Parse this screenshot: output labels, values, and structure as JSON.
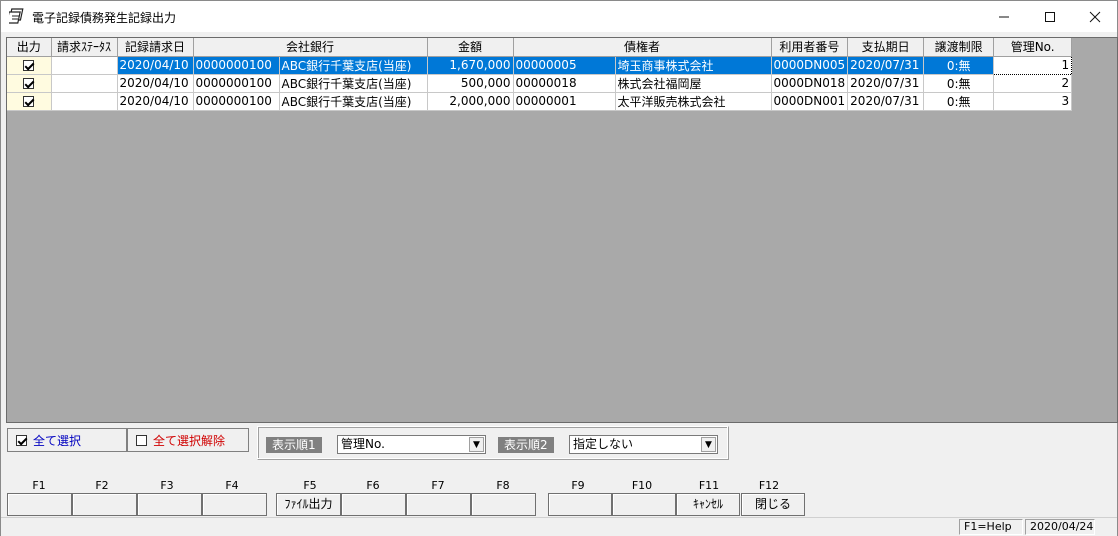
{
  "window": {
    "title": "電子記録債務発生記録出力"
  },
  "grid": {
    "columns": [
      "出力",
      "請求ｽﾃｰﾀｽ",
      "記録請求日",
      "会社銀行",
      "金額",
      "債権者",
      "利用者番号",
      "支払期日",
      "譲渡制限",
      "管理No."
    ],
    "rows": [
      {
        "checked": true,
        "status": "",
        "date": "2020/04/10",
        "company_code": "0000000100",
        "bank": "ABC銀行千葉支店(当座)",
        "amount": "1,670,000",
        "creditor_code": "00000005",
        "creditor_name": "埼玉商事株式会社",
        "user_no": "0000DN005",
        "due_date": "2020/07/31",
        "transfer": "0:無",
        "mgr_no": "1"
      },
      {
        "checked": true,
        "status": "",
        "date": "2020/04/10",
        "company_code": "0000000100",
        "bank": "ABC銀行千葉支店(当座)",
        "amount": "500,000",
        "creditor_code": "00000018",
        "creditor_name": "株式会社福岡屋",
        "user_no": "0000DN018",
        "due_date": "2020/07/31",
        "transfer": "0:無",
        "mgr_no": "2"
      },
      {
        "checked": true,
        "status": "",
        "date": "2020/04/10",
        "company_code": "0000000100",
        "bank": "ABC銀行千葉支店(当座)",
        "amount": "2,000,000",
        "creditor_code": "00000001",
        "creditor_name": "太平洋販売株式会社",
        "user_no": "0000DN001",
        "due_date": "2020/07/31",
        "transfer": "0:無",
        "mgr_no": "3"
      }
    ]
  },
  "controls": {
    "select_all": "全て選択",
    "deselect_all": "全て選択解除",
    "sort1_label": "表示順1",
    "sort1_value": "管理No.",
    "sort2_label": "表示順2",
    "sort2_value": "指定しない",
    "colors": {
      "select_all_text": "#0000c0",
      "deselect_all_text": "#d00000",
      "selection": "#0078d7"
    }
  },
  "fkeys": [
    {
      "key": "F1",
      "label": ""
    },
    {
      "key": "F2",
      "label": ""
    },
    {
      "key": "F3",
      "label": ""
    },
    {
      "key": "F4",
      "label": ""
    },
    {
      "key": "F5",
      "label": "ﾌｧｲﾙ出力"
    },
    {
      "key": "F6",
      "label": ""
    },
    {
      "key": "F7",
      "label": ""
    },
    {
      "key": "F8",
      "label": ""
    },
    {
      "key": "F9",
      "label": ""
    },
    {
      "key": "F10",
      "label": ""
    },
    {
      "key": "F11",
      "label": "ｷｬﾝｾﾙ"
    },
    {
      "key": "F12",
      "label": "閉じる"
    }
  ],
  "status": {
    "help": "F1=Help",
    "date": "2020/04/24"
  }
}
